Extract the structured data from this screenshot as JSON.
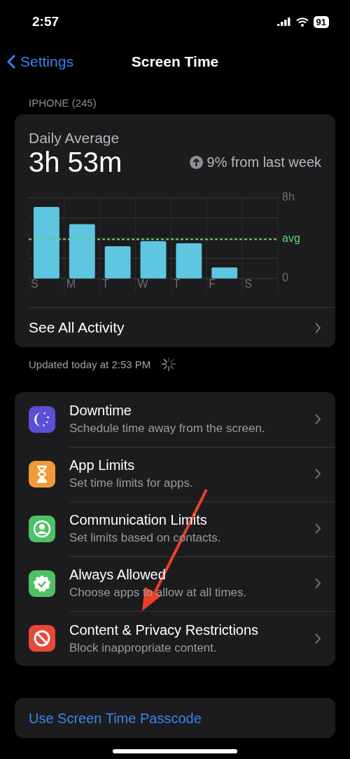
{
  "status_bar": {
    "time": "2:57",
    "battery": "91"
  },
  "nav": {
    "back": "Settings",
    "title": "Screen Time"
  },
  "section_header": "IPHONE (245)",
  "summary": {
    "label": "Daily Average",
    "value": "3h 53m",
    "trend": "9% from last week",
    "chart_data": {
      "type": "bar",
      "categories": [
        "S",
        "M",
        "T",
        "W",
        "T",
        "F",
        "S"
      ],
      "values": [
        7.1,
        5.4,
        3.2,
        3.7,
        3.5,
        1.1,
        null
      ],
      "ylim": [
        0,
        8
      ],
      "yticks": [
        0,
        {
          "value": 8,
          "label": "8h"
        }
      ],
      "ref_lines": [
        {
          "axis": "y",
          "value": 3.88,
          "label": "avg"
        }
      ]
    },
    "link": "See All Activity"
  },
  "updated": "Updated today at 2:53 PM",
  "settings": [
    {
      "kind": "downtime",
      "color": "#5b4fd6",
      "title": "Downtime",
      "subtitle": "Schedule time away from the screen."
    },
    {
      "kind": "app_limits",
      "color": "#f19a38",
      "title": "App Limits",
      "subtitle": "Set time limits for apps."
    },
    {
      "kind": "communication",
      "color": "#4fc164",
      "title": "Communication Limits",
      "subtitle": "Set limits based on contacts."
    },
    {
      "kind": "always_allowed",
      "color": "#4fc164",
      "title": "Always Allowed",
      "subtitle": "Choose apps to allow at all times."
    },
    {
      "kind": "restrictions",
      "color": "#e8473c",
      "title": "Content & Privacy Restrictions",
      "subtitle": "Block inappropriate content."
    }
  ],
  "passcode_link": "Use Screen Time Passcode"
}
